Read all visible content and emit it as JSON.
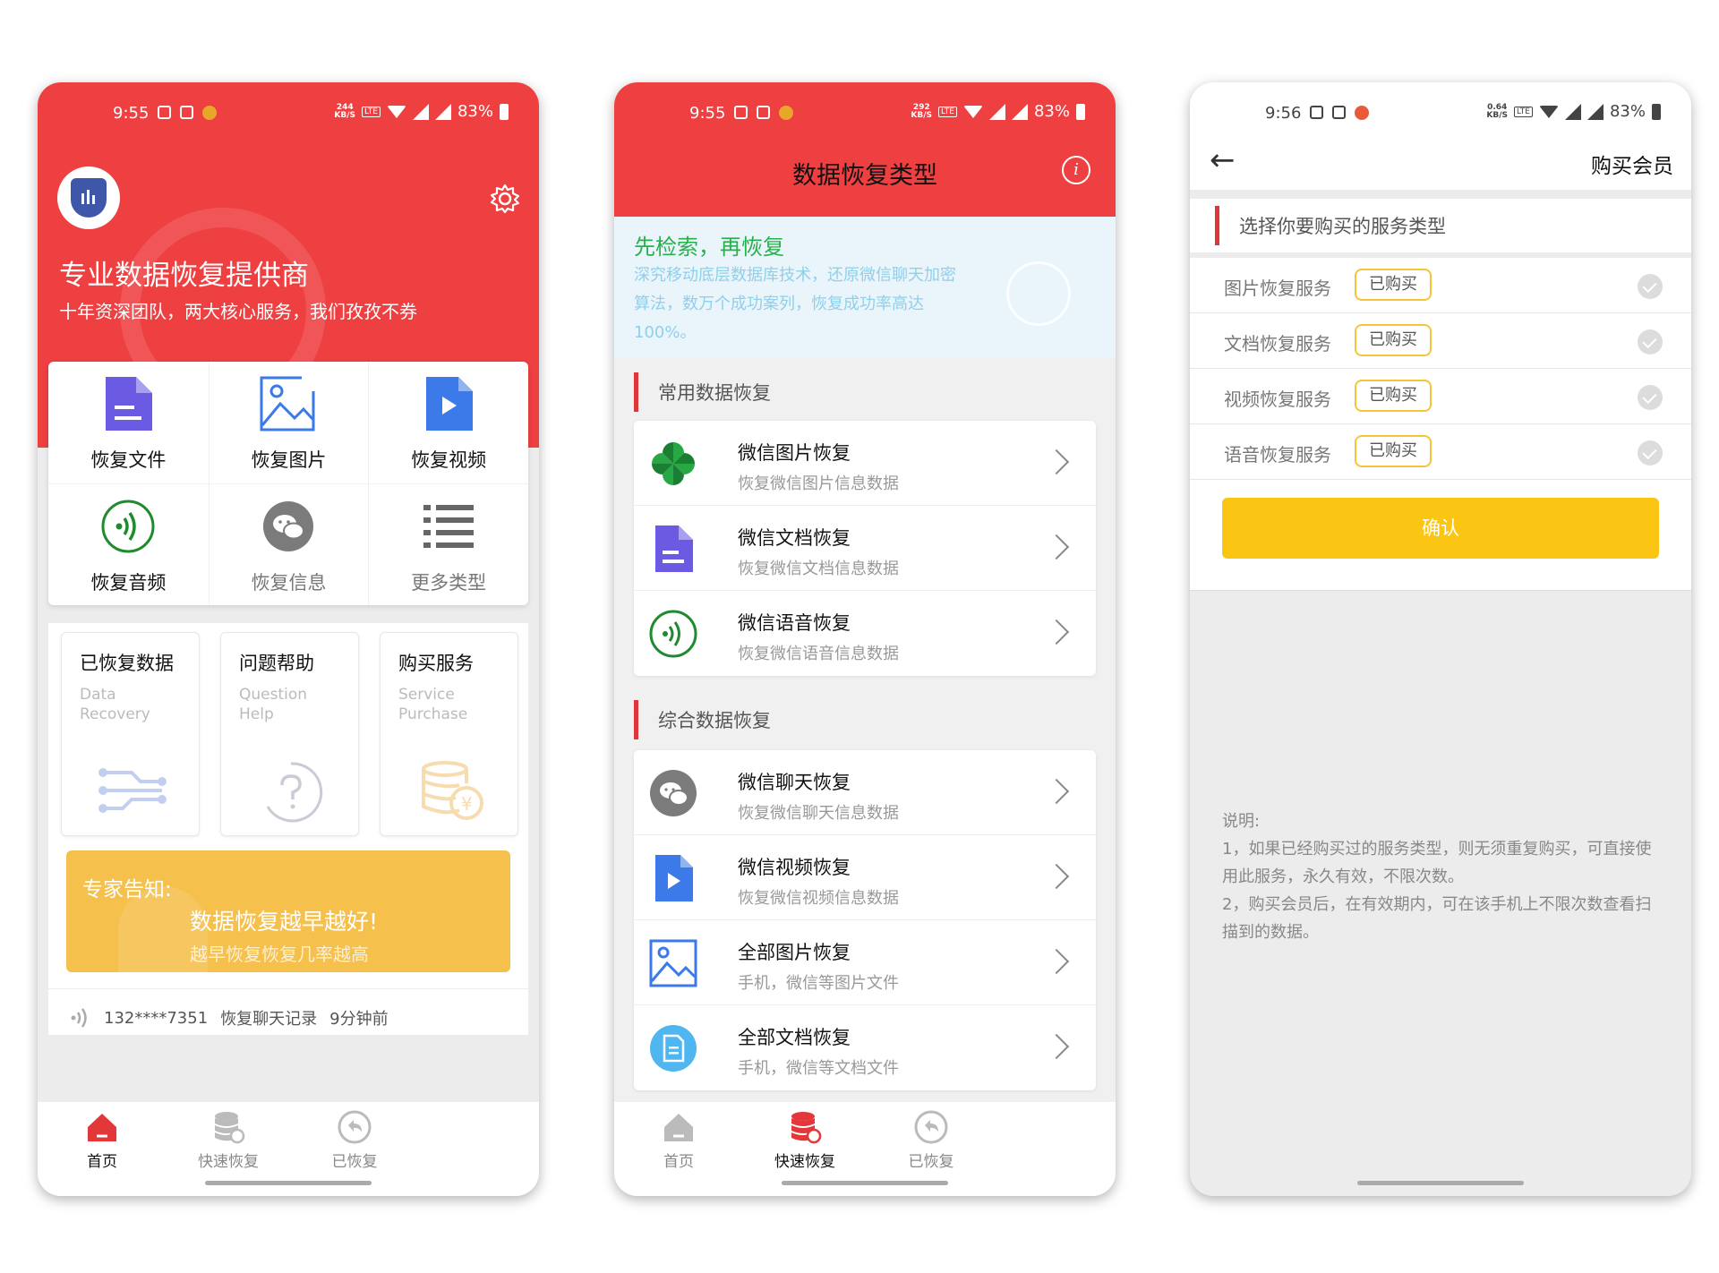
{
  "status_p1": {
    "time": "9:55",
    "speed": "244",
    "speed_unit": "KB/S",
    "lte": "LTE",
    "battery": "83%"
  },
  "status_p2": {
    "time": "9:55",
    "speed": "292",
    "speed_unit": "KB/S",
    "lte": "LTE",
    "battery": "83%"
  },
  "status_p3": {
    "time": "9:56",
    "speed": "0.64",
    "speed_unit": "KB/S",
    "lte": "LTE",
    "battery": "83%"
  },
  "home": {
    "title": "专业数据恢复提供商",
    "subtitle": "十年资深团队，两大核心服务，我们孜孜不券",
    "grid": [
      {
        "label": "恢复文件",
        "icon": "document-icon"
      },
      {
        "label": "恢复图片",
        "icon": "image-icon"
      },
      {
        "label": "恢复视频",
        "icon": "video-icon"
      },
      {
        "label": "恢复音频",
        "icon": "audio-icon"
      },
      {
        "label": "恢复信息",
        "icon": "chat-icon"
      },
      {
        "label": "更多类型",
        "icon": "list-icon"
      }
    ],
    "cards": [
      {
        "title": "已恢复数据",
        "en": "Data\nRecovery"
      },
      {
        "title": "问题帮助",
        "en": "Question\nHelp"
      },
      {
        "title": "购买服务",
        "en": "Service\nPurchase"
      }
    ],
    "tip": {
      "label": "专家告知:",
      "main": "数据恢复越早越好!",
      "sub": "越早恢复恢复几率越高"
    },
    "ticker": {
      "phone": "132****7351",
      "action": "恢复聊天记录",
      "time": "9分钟前"
    }
  },
  "tabs": [
    {
      "label": "首页"
    },
    {
      "label": "快速恢复"
    },
    {
      "label": "已恢复"
    }
  ],
  "recovery": {
    "title": "数据恢复类型",
    "banner_title": "先检索，再恢复",
    "banner_text": "深究移动底层数据库技术，还原微信聊天加密算法，数万个成功案列，恢复成功率高达100%。",
    "section1": "常用数据恢复",
    "section2": "综合数据恢复",
    "common": [
      {
        "title": "微信图片恢复",
        "sub": "恢复微信图片信息数据",
        "icon": "pinwheel-icon"
      },
      {
        "title": "微信文档恢复",
        "sub": "恢复微信文档信息数据",
        "icon": "document-icon"
      },
      {
        "title": "微信语音恢复",
        "sub": "恢复微信语音信息数据",
        "icon": "audio-icon"
      }
    ],
    "general": [
      {
        "title": "微信聊天恢复",
        "sub": "恢复微信聊天信息数据",
        "icon": "chat-icon"
      },
      {
        "title": "微信视频恢复",
        "sub": "恢复微信视频信息数据",
        "icon": "video-icon"
      },
      {
        "title": "全部图片恢复",
        "sub": "手机，微信等图片文件",
        "icon": "image-icon"
      },
      {
        "title": "全部文档恢复",
        "sub": "手机，微信等文档文件",
        "icon": "file-text-icon"
      }
    ]
  },
  "purchase": {
    "title": "购买会员",
    "back": "←",
    "select_label": "选择你要购买的服务类型",
    "services": [
      {
        "name": "图片恢复服务",
        "badge": "已购买"
      },
      {
        "name": "文档恢复服务",
        "badge": "已购买"
      },
      {
        "name": "视频恢复服务",
        "badge": "已购买"
      },
      {
        "name": "语音恢复服务",
        "badge": "已购买"
      }
    ],
    "confirm": "确认",
    "notes": [
      "说明:",
      "1，如果已经购买过的服务类型，则无须重复购买，可直接使用此服务，永久有效，不限次数。",
      "2，购买会员后，在有效期内，可在该手机上不限次数查看扫描到的数据。"
    ]
  },
  "colors": {
    "red": "#ee3f41",
    "yellow": "#fbc613",
    "green": "#26b14a",
    "indigo": "#6a5be2",
    "blue": "#3b7ae8"
  }
}
